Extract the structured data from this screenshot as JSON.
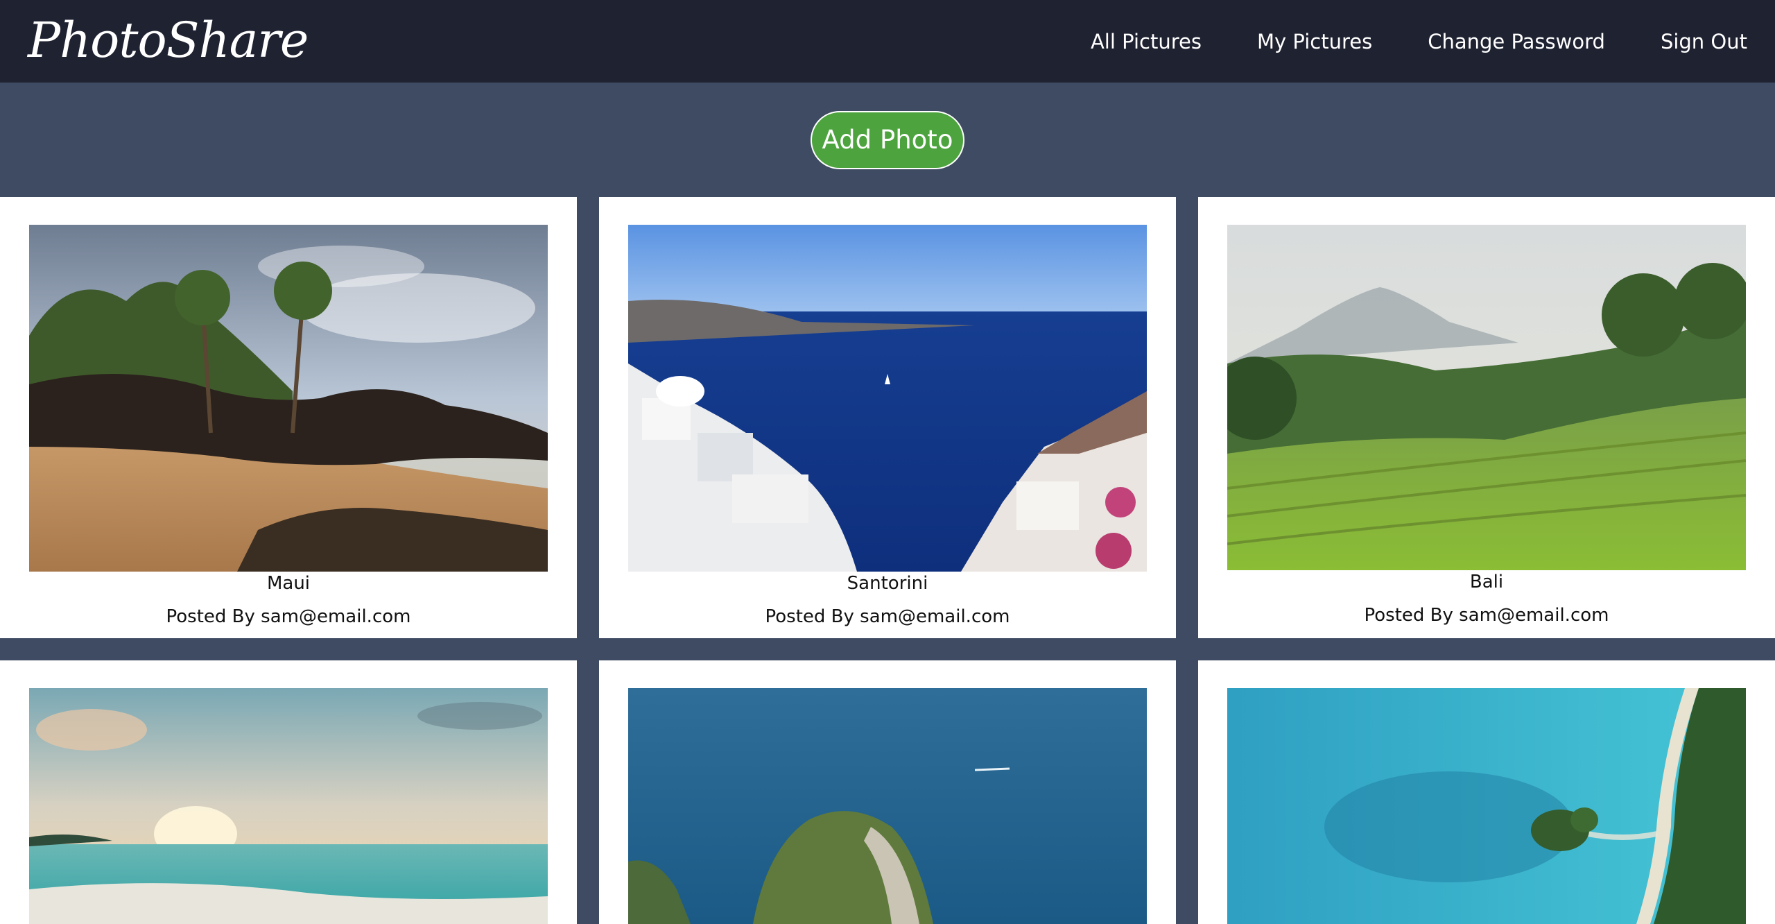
{
  "navbar": {
    "brand": "PhotoShare",
    "links": [
      "All Pictures",
      "My Pictures",
      "Change Password",
      "Sign Out"
    ]
  },
  "actions": {
    "add_photo_label": "Add Photo",
    "add_photo_color": "#4da43e"
  },
  "photos": [
    {
      "title": "Maui",
      "poster": "Posted By sam@email.com",
      "scene": "tropical beach with palm trees and rocks"
    },
    {
      "title": "Santorini",
      "poster": "Posted By sam@email.com",
      "scene": "white buildings overlooking deep blue sea"
    },
    {
      "title": "Bali",
      "poster": "Posted By sam@email.com",
      "scene": "green rice terraces with misty mountain"
    },
    {
      "title": "",
      "poster": "",
      "scene": "sunset over turquoise beach"
    },
    {
      "title": "",
      "poster": "",
      "scene": "rock island in deep blue ocean"
    },
    {
      "title": "",
      "poster": "",
      "scene": "aerial view of turquoise lagoon and island"
    }
  ],
  "colors": {
    "navbar_bg": "#1f2231",
    "page_bg": "#3f4b62",
    "card_bg": "#ffffff"
  }
}
